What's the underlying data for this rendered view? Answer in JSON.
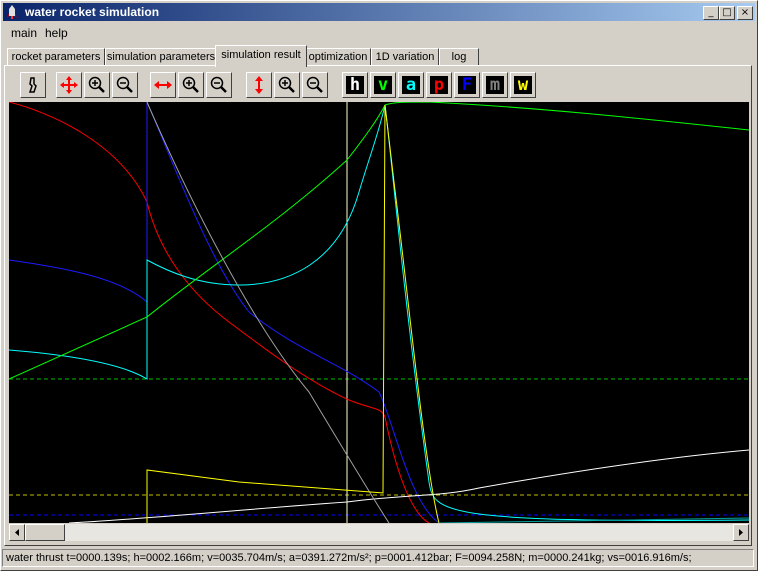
{
  "window": {
    "title": "water rocket simulation",
    "controls": {
      "minimize": "_",
      "maximize": "□",
      "close": "×"
    }
  },
  "menu": [
    {
      "label": "main"
    },
    {
      "label": "help"
    }
  ],
  "tabs": [
    {
      "label": "rocket parameters"
    },
    {
      "label": "simulation parameters"
    },
    {
      "label": "simulation result",
      "active": true
    },
    {
      "label": "optimization"
    },
    {
      "label": "1D variation"
    },
    {
      "label": "log"
    }
  ],
  "toolbar": {
    "series_toggles": [
      {
        "letter": "h",
        "color": "#ffffff"
      },
      {
        "letter": "v",
        "color": "#00ff00"
      },
      {
        "letter": "a",
        "color": "#00ffff"
      },
      {
        "letter": "p",
        "color": "#ff0000"
      },
      {
        "letter": "F",
        "color": "#0000ff"
      },
      {
        "letter": "m",
        "color": "#808080"
      },
      {
        "letter": "w",
        "color": "#ffff00"
      }
    ]
  },
  "status": {
    "text": "water thrust t=0000.139s; h=0002.166m; v=0035.704m/s; a=0391.272m/s²; p=0001.412bar; F=0094.258N; m=0000.241kg; vs=0016.916m/s;"
  }
}
